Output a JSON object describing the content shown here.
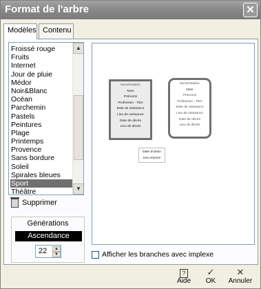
{
  "window": {
    "title": "Format de l'arbre",
    "close_icon": "✕"
  },
  "tabs": [
    {
      "label": "Modèles"
    },
    {
      "label": "Contenu"
    }
  ],
  "models": {
    "items": [
      "Froissé rouge",
      "Fruits",
      "Internet",
      "Jour de pluie",
      "Médor",
      "Noir&Blanc",
      "Océan",
      "Parchemin",
      "Pastels",
      "Peintures",
      "Plage",
      "Printemps",
      "Provence",
      "Sans bordure",
      "Soleil",
      "Spirales bleues",
      "Sport",
      "Théâtre"
    ],
    "selected": "Sport",
    "delete_label": "Supprimer"
  },
  "generations": {
    "title": "Générations",
    "mode": "Ascendance",
    "count": "22"
  },
  "preview": {
    "card_fields": [
      "Numérotation",
      "Nom",
      "Prénoms",
      "Profession - Titre",
      "Date de naissance",
      "Lieu de naissance",
      "Date de décès",
      "Lieu de décès"
    ],
    "union_fields": [
      "Date d'union",
      "Lieu d'union"
    ]
  },
  "options": {
    "implex_label": "Afficher les branches avec implexe",
    "implex_checked": false
  },
  "footer": {
    "help_label": "Aide",
    "ok_label": "OK",
    "cancel_label": "Annuler"
  },
  "colors": {
    "selection": "#707070",
    "title_bar": "#8a8a8a"
  }
}
